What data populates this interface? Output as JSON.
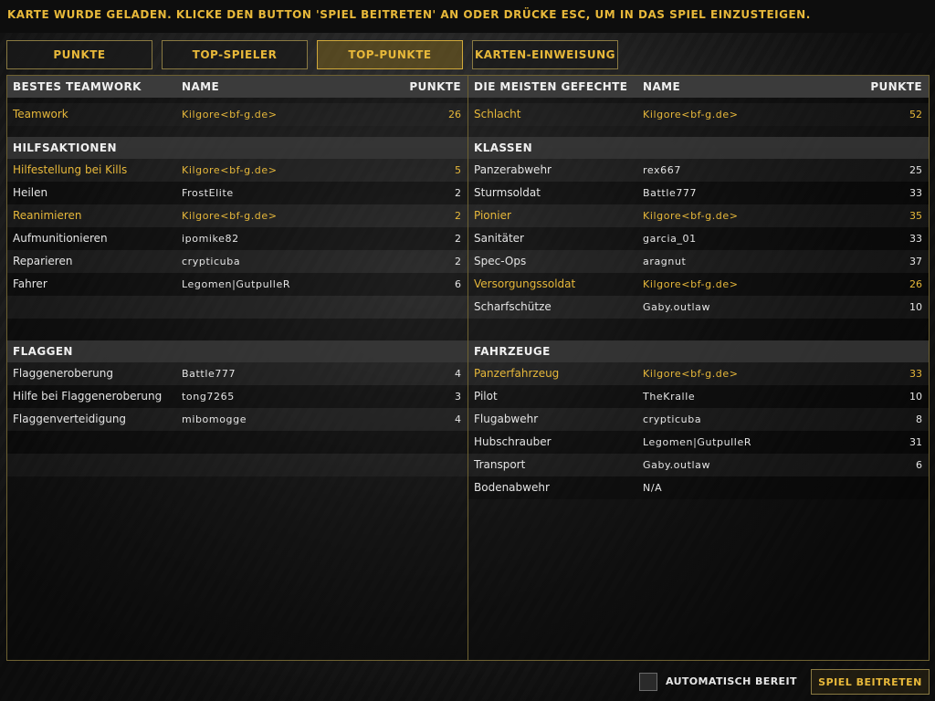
{
  "header": {
    "message": "KARTE WURDE GELADEN. KLICKE DEN BUTTON 'SPIEL BEITRETEN' AN ODER DRÜCKE ESC, UM IN DAS SPIEL EINZUSTEIGEN."
  },
  "tabs": [
    {
      "label": "PUNKTE"
    },
    {
      "label": "TOP-SPIELER"
    },
    {
      "label": "TOP-PUNKTE"
    },
    {
      "label": "KARTEN-EINWEISUNG"
    }
  ],
  "left": {
    "head": {
      "cat": "BESTES TEAMWORK",
      "name": "NAME",
      "pts": "PUNKTE"
    },
    "teamwork": {
      "cat": "Teamwork",
      "name": "Kilgore<bf-g.de>",
      "pts": "26"
    },
    "hilfe_title": "HILFSAKTIONEN",
    "hilfe": [
      {
        "cat": "Hilfestellung bei Kills",
        "name": "Kilgore<bf-g.de>",
        "pts": "5"
      },
      {
        "cat": "Heilen",
        "name": "FrostElite",
        "pts": "2"
      },
      {
        "cat": "Reanimieren",
        "name": "Kilgore<bf-g.de>",
        "pts": "2"
      },
      {
        "cat": "Aufmunitionieren",
        "name": "ipomike82",
        "pts": "2"
      },
      {
        "cat": "Reparieren",
        "name": "crypticuba",
        "pts": "2"
      },
      {
        "cat": "Fahrer",
        "name": "Legomen|GutpulleR",
        "pts": "6"
      }
    ],
    "flaggen_title": "FLAGGEN",
    "flaggen": [
      {
        "cat": "Flaggeneroberung",
        "name": "Battle777",
        "pts": "4"
      },
      {
        "cat": "Hilfe bei Flaggeneroberung",
        "name": "tong7265",
        "pts": "3"
      },
      {
        "cat": "Flaggenverteidigung",
        "name": "mibomogge",
        "pts": "4"
      }
    ]
  },
  "right": {
    "head": {
      "cat": "DIE MEISTEN GEFECHTE",
      "name": "NAME",
      "pts": "PUNKTE"
    },
    "schlacht": {
      "cat": "Schlacht",
      "name": "Kilgore<bf-g.de>",
      "pts": "52"
    },
    "klassen_title": "KLASSEN",
    "klassen": [
      {
        "cat": "Panzerabwehr",
        "name": "rex667",
        "pts": "25"
      },
      {
        "cat": "Sturmsoldat",
        "name": "Battle777",
        "pts": "33"
      },
      {
        "cat": "Pionier",
        "name": "Kilgore<bf-g.de>",
        "pts": "35"
      },
      {
        "cat": "Sanitäter",
        "name": "garcia_01",
        "pts": "33"
      },
      {
        "cat": "Spec-Ops",
        "name": "aragnut",
        "pts": "37"
      },
      {
        "cat": "Versorgungssoldat",
        "name": "Kilgore<bf-g.de>",
        "pts": "26"
      },
      {
        "cat": "Scharfschütze",
        "name": "Gaby.outlaw",
        "pts": "10"
      }
    ],
    "fahrzeuge_title": "FAHRZEUGE",
    "fahrzeuge": [
      {
        "cat": "Panzerfahrzeug",
        "name": "Kilgore<bf-g.de>",
        "pts": "33"
      },
      {
        "cat": "Pilot",
        "name": "TheKralle",
        "pts": "10"
      },
      {
        "cat": "Flugabwehr",
        "name": "crypticuba",
        "pts": "8"
      },
      {
        "cat": "Hubschrauber",
        "name": "Legomen|GutpulleR",
        "pts": "31"
      },
      {
        "cat": "Transport",
        "name": "Gaby.outlaw",
        "pts": "6"
      },
      {
        "cat": "Bodenabwehr",
        "name": "N/A",
        "pts": ""
      }
    ]
  },
  "footer": {
    "auto_ready_label": "AUTOMATISCH BEREIT",
    "join_label": "SPIEL BEITRETEN"
  },
  "colors": {
    "accent": "#e7b83a",
    "highlight_player": "Kilgore<bf-g.de>"
  }
}
